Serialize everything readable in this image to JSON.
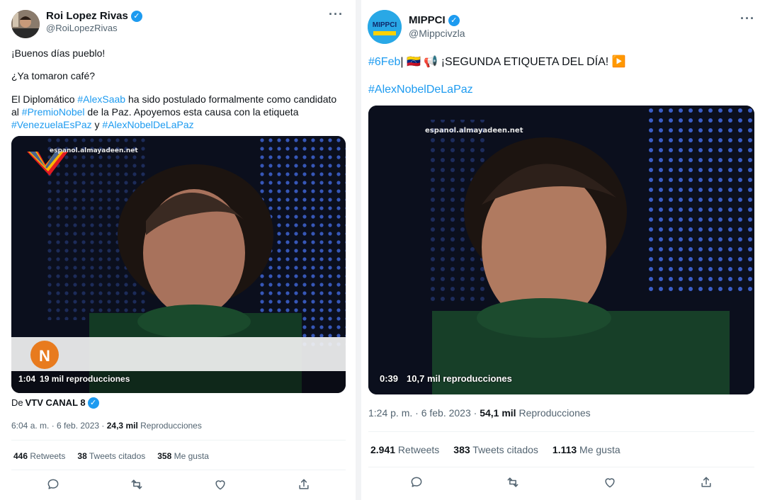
{
  "tweet1": {
    "author_name": "Roi Lopez Rivas",
    "author_handle": "@RoiLopezRivas",
    "line1": "¡Buenos días pueblo!",
    "line2": "¿Ya tomaron café?",
    "body_p1": "El Diplomático ",
    "tag_alexsaab": "#AlexSaab",
    "body_p2": " ha sido postulado formalmente como candidato al ",
    "tag_premionobel": "#PremioNobel",
    "body_p3": " de la Paz. Apoyemos esta causa con la etiqueta ",
    "tag_venezuela": "#VenezuelaEsPaz",
    "body_p4": " y ",
    "tag_alexnobel": "#AlexNobelDeLaPaz",
    "video_watermark": "espanol.almayadeen.net",
    "video_duration": "1:04",
    "video_views": "19 mil reproducciones",
    "source_prefix": "De ",
    "source_name": "VTV CANAL 8",
    "timestamp": "6:04 a. m. · 6 feb. 2023 · ",
    "views_count": "24,3 mil",
    "views_label": " Reproducciones",
    "retweets_count": "446",
    "retweets_label": " Retweets",
    "quotes_count": "38",
    "quotes_label": " Tweets citados",
    "likes_count": "358",
    "likes_label": " Me gusta"
  },
  "tweet2": {
    "author_name": "MIPPCI",
    "author_handle": "@Mippcivzla",
    "avatar_text": "MIPPCI",
    "tag_6feb": "#6Feb",
    "line1_rest": "| 🇻🇪 📢 ¡SEGUNDA ETIQUETA DEL DÍA! ▶️",
    "tag_alexnobel": "#AlexNobelDeLaPaz",
    "video_watermark": "espanol.almayadeen.net",
    "video_duration": "0:39",
    "video_views": "10,7 mil reproducciones",
    "timestamp": "1:24 p. m. · 6 feb. 2023 · ",
    "views_count": "54,1 mil",
    "views_label": " Reproducciones",
    "retweets_count": "2.941",
    "retweets_label": " Retweets",
    "quotes_count": "383",
    "quotes_label": " Tweets citados",
    "likes_count": "1.113",
    "likes_label": " Me gusta"
  },
  "colors": {
    "link": "#1d9bf0",
    "text": "#0f1419",
    "muted": "#536471",
    "divider": "#eff3f4"
  },
  "icons": [
    "verified-icon",
    "more-icon",
    "reply-icon",
    "retweet-icon",
    "like-icon",
    "share-icon",
    "play-icon"
  ]
}
